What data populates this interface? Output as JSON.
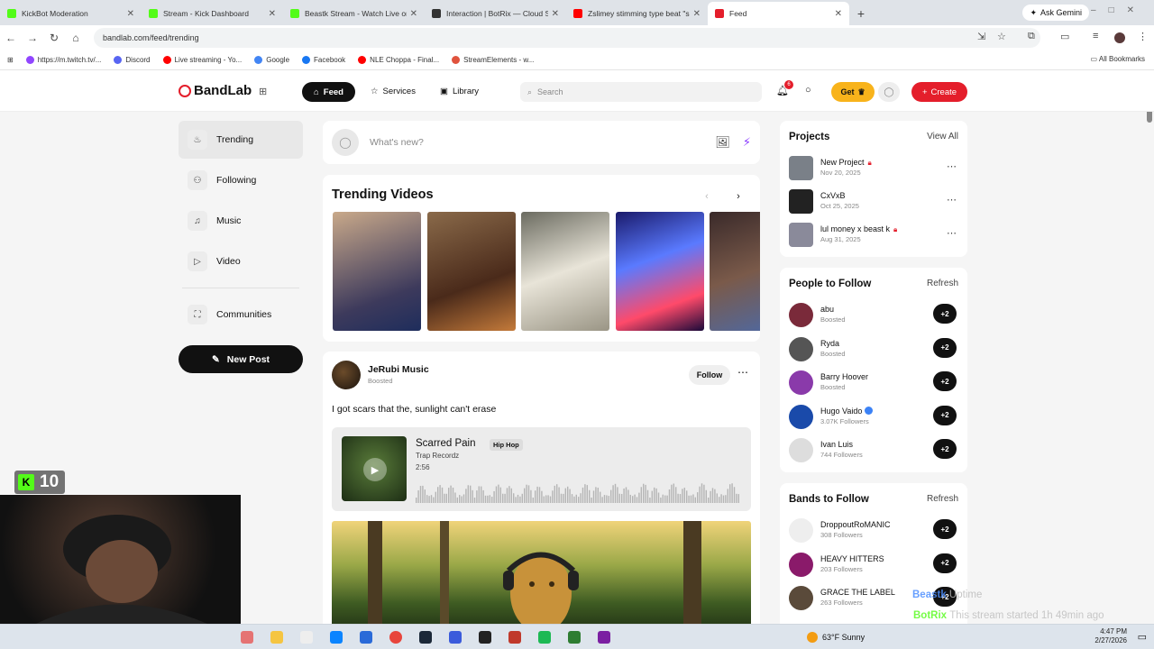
{
  "browser": {
    "tabs": [
      {
        "title": "KickBot Moderation",
        "color": "#53fc18",
        "active": false
      },
      {
        "title": "Stream - Kick Dashboard",
        "color": "#53fc18",
        "active": false
      },
      {
        "title": "Beastk Stream - Watch Live on",
        "color": "#53fc18",
        "active": false
      },
      {
        "title": "Interaction | BotRix — Cloud St",
        "color": "#333333",
        "active": false
      },
      {
        "title": "Zslimey stimming type beat \"sn",
        "color": "#ff0000",
        "active": false
      },
      {
        "title": "Feed",
        "color": "#e41e2b",
        "active": true
      }
    ],
    "ask_gemini": "Ask Gemini",
    "url": "bandlab.com/feed/trending",
    "bookmarks": [
      {
        "label": "https://m.twitch.tv/...",
        "color": "#9146ff"
      },
      {
        "label": "Discord",
        "color": "#5865f2"
      },
      {
        "label": "Live streaming - Yo...",
        "color": "#ff0000"
      },
      {
        "label": "Google",
        "color": "#4285f4"
      },
      {
        "label": "Facebook",
        "color": "#1877f2"
      },
      {
        "label": "NLE Choppa - Final...",
        "color": "#ff0000"
      },
      {
        "label": "StreamElements - w...",
        "color": "#e0533d"
      }
    ],
    "all_bookmarks": "All Bookmarks"
  },
  "header": {
    "brand": "BandLab",
    "feed": "Feed",
    "services": "Services",
    "library": "Library",
    "search_placeholder": "Search",
    "notif_count": "6",
    "get": "Get",
    "create": "Create"
  },
  "sidebar": {
    "items": [
      {
        "label": "Trending",
        "icon": "flame-icon"
      },
      {
        "label": "Following",
        "icon": "people-icon"
      },
      {
        "label": "Music",
        "icon": "music-note-icon"
      },
      {
        "label": "Video",
        "icon": "video-icon"
      }
    ],
    "communities": "Communities",
    "new_post": "New Post"
  },
  "composer": {
    "placeholder": "What's new?"
  },
  "trending": {
    "title": "Trending Videos",
    "thumbs": [
      {
        "bg": "linear-gradient(160deg,#c9a98a,#3d3a5c 70%,#1e2d5c)"
      },
      {
        "bg": "linear-gradient(160deg,#8a6a4a,#4a2a1a 60%,#c47a3a)"
      },
      {
        "bg": "linear-gradient(160deg,#6b6b60,#e8e4d8 50%,#9a9585)"
      },
      {
        "bg": "linear-gradient(160deg,#1a1a6b,#5a7aff 40%,#ff4a6a 75%,#1a0a3a)"
      },
      {
        "bg": "linear-gradient(160deg,#3a2a2a,#7a5a4a 50%,#4a6aaa)"
      }
    ]
  },
  "post": {
    "author": "JeRubi Music",
    "status": "Boosted",
    "follow": "Follow",
    "text": "I got scars that the, sunlight can't erase",
    "track": {
      "title": "Scarred Pain",
      "genre": "Hip Hop",
      "artist": "Trap Recordz",
      "duration": "2:56"
    }
  },
  "projects": {
    "title": "Projects",
    "view_all": "View All",
    "items": [
      {
        "name": "New Project",
        "date": "Nov 20, 2025",
        "locked": true,
        "bg": "#7a8088"
      },
      {
        "name": "CxVxB",
        "date": "Oct 25, 2025",
        "locked": false,
        "bg": "#222222"
      },
      {
        "name": "lul money x beast k",
        "date": "Aug 31, 2025",
        "locked": true,
        "bg": "#8a8a9a"
      }
    ]
  },
  "people": {
    "title": "People to Follow",
    "refresh": "Refresh",
    "items": [
      {
        "name": "abu",
        "sub": "Boosted",
        "verified": false,
        "bg": "#7a2a3a"
      },
      {
        "name": "Ryda",
        "sub": "Boosted",
        "verified": false,
        "bg": "#555555"
      },
      {
        "name": "Barry Hoover",
        "sub": "Boosted",
        "verified": false,
        "bg": "#8a3aaa"
      },
      {
        "name": "Hugo Vaido",
        "sub": "3.07K Followers",
        "verified": true,
        "bg": "#1a4aaa"
      },
      {
        "name": "Ivan Luis",
        "sub": "744 Followers",
        "verified": false,
        "bg": "#dddddd"
      }
    ],
    "follow_label": "+2"
  },
  "bands": {
    "title": "Bands to Follow",
    "refresh": "Refresh",
    "items": [
      {
        "name": "DroppoutRoMANIC",
        "sub": "308 Followers",
        "bg": "#eeeeee"
      },
      {
        "name": "HEAVY HITTERS",
        "sub": "203 Followers",
        "bg": "#8a1a6a"
      },
      {
        "name": "GRACE THE LABEL",
        "sub": "263 Followers",
        "bg": "#5a4a3a"
      }
    ]
  },
  "stream": {
    "kick_count": "10",
    "overlay_name": "Beastk",
    "overlay_uptime": "Uptime",
    "overlay_bot": "BotRix",
    "overlay_msg": "This stream started 1h 49min ago"
  },
  "taskbar": {
    "weather": "63°F  Sunny",
    "time": "4:47 PM",
    "date": "2/27/2026"
  }
}
